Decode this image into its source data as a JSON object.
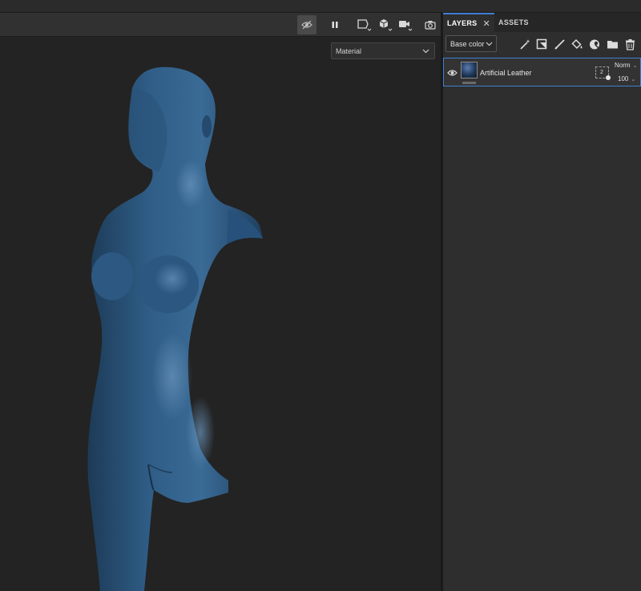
{
  "toolbar": {
    "buttons": [
      {
        "name": "hide-ui-icon",
        "active": true
      },
      {
        "name": "pause-icon"
      },
      {
        "name": "viewport-mode-icon"
      },
      {
        "name": "cube-icon"
      },
      {
        "name": "camera-icon"
      },
      {
        "name": "screenshot-icon"
      }
    ]
  },
  "viewport": {
    "display_mode": "Material",
    "mesh_color": "#2f5d86"
  },
  "panel": {
    "tabs": [
      {
        "label": "LAYERS",
        "active": true,
        "closable": true
      },
      {
        "label": "ASSETS",
        "active": false
      }
    ],
    "channel_select": "Base color",
    "tools": [
      "add-effect-icon",
      "add-mask-icon",
      "paint-brush-icon",
      "fill-bucket-icon",
      "smart-material-icon",
      "folder-icon",
      "trash-icon"
    ],
    "layers": [
      {
        "name": "Artificial Leather",
        "visible": true,
        "mask_count": "2",
        "blend_mode": "Norm",
        "opacity": "100"
      }
    ]
  },
  "colors": {
    "accent": "#3f7fd6",
    "panel_bg": "#2e2e2e",
    "viewport_bg": "#232323"
  }
}
